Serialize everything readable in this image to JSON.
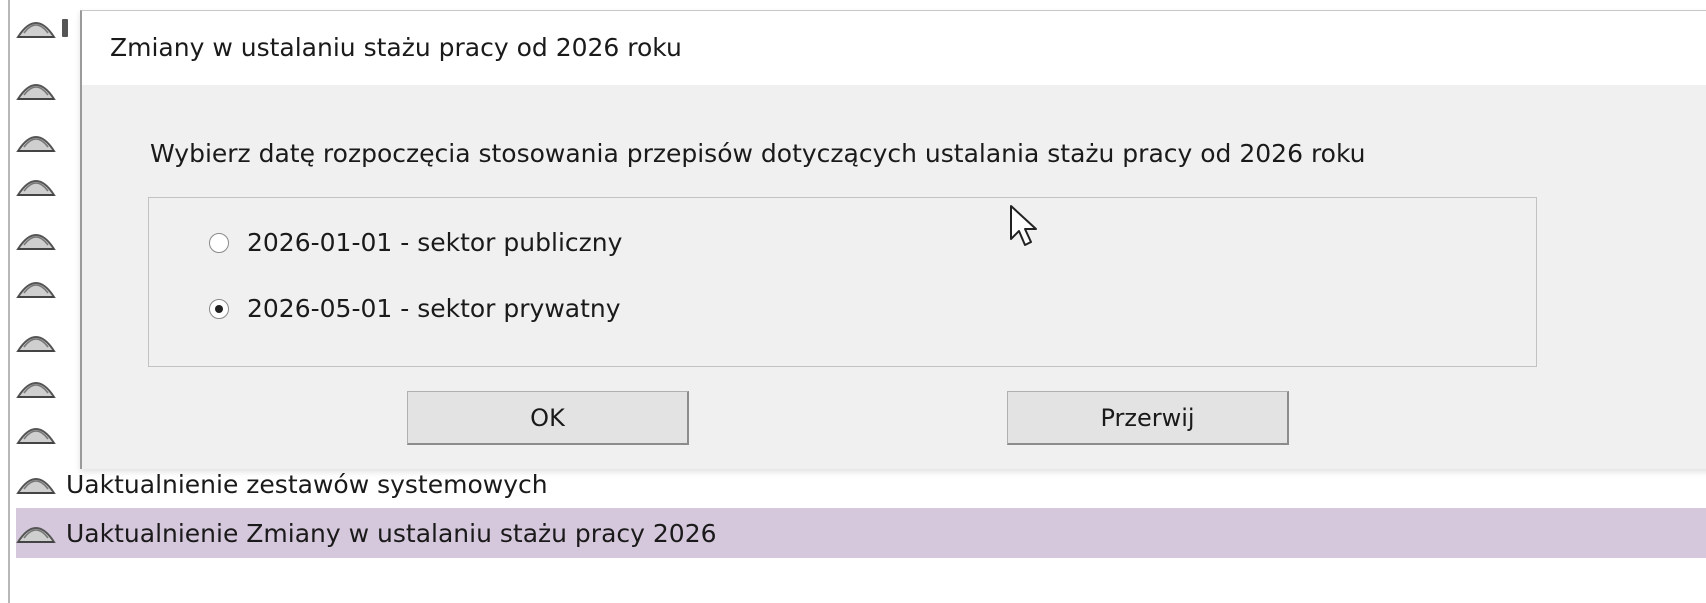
{
  "dialog": {
    "title": "Zmiany w ustalaniu stażu pracy od 2026 roku",
    "prompt": "Wybierz datę rozpoczęcia stosowania przepisów dotyczących ustalania stażu pracy od 2026 roku",
    "options": [
      {
        "label": "2026-01-01 - sektor publiczny",
        "checked": false
      },
      {
        "label": "2026-05-01 - sektor prywatny",
        "checked": true
      }
    ],
    "ok_label": "OK",
    "cancel_label": "Przerwij"
  },
  "background_list": {
    "icon": "update-icon",
    "items": [
      {
        "label": "Uaktualnienie zestawów systemowych",
        "selected": false
      },
      {
        "label": "Uaktualnienie Zmiany w ustalaniu stażu pracy 2026",
        "selected": true
      }
    ]
  },
  "colors": {
    "selection": "#d6c8dc",
    "dialog_bg": "#f0f0f0"
  }
}
